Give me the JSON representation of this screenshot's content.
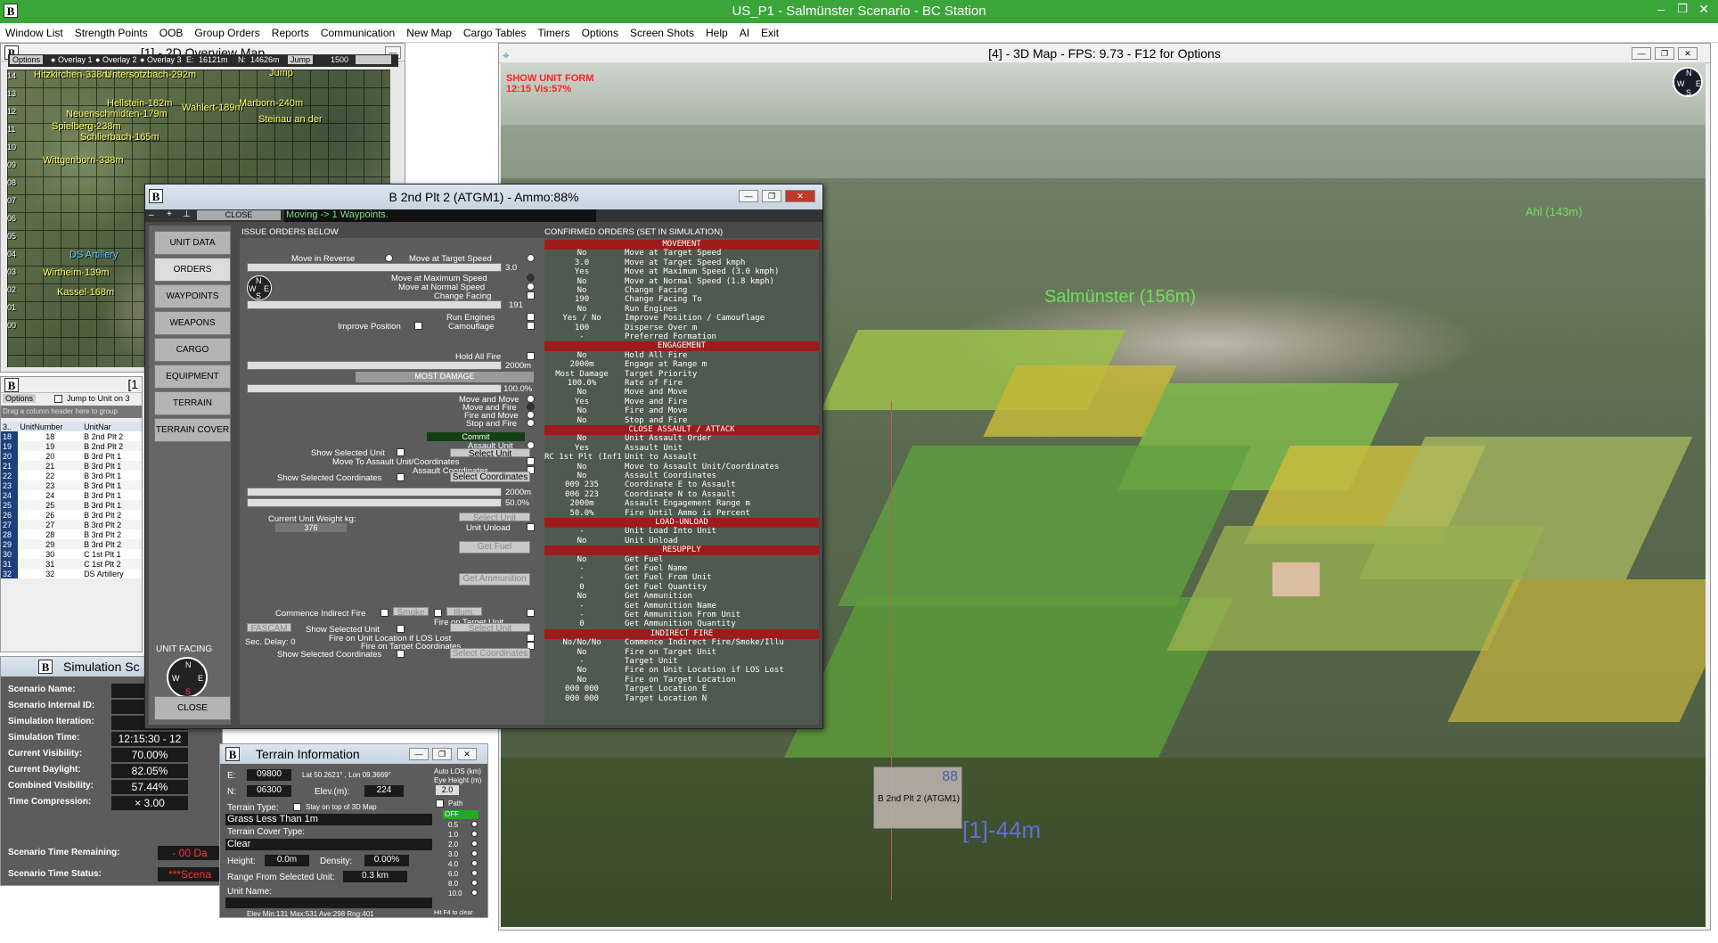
{
  "app": {
    "title": "US_P1 - Salmünster Scenario - BC Station"
  },
  "menu": [
    "Window List",
    "Strength Points",
    "OOB",
    "Group Orders",
    "Reports",
    "Communication",
    "New Map",
    "Cargo Tables",
    "Timers",
    "Options",
    "Screen Shots",
    "Help",
    "AI",
    "Exit"
  ],
  "overview": {
    "title": "[1] - 2D Overview Map",
    "options_label": "Options",
    "overlays": [
      "Overlay 1",
      "Overlay 2",
      "Overlay 3"
    ],
    "e_label": "E:",
    "e_val": "16121m",
    "n_label": "N:",
    "n_val": "14626m",
    "jump": "Jump",
    "zoom": "1500",
    "towns": [
      "Hitzkirchen-338m",
      "Untersotzbach-292m",
      "Jump",
      "Hellstein-182m",
      "Wahlert-189m",
      "Marborn-240m",
      "Neuenschmidten-179m",
      "Spielberg-238m",
      "Steinau an der",
      "Schlierbach-165m",
      "Wittgenborn-338m",
      "DS Artillery",
      "Wirtheim-139m",
      "Kassel-168m"
    ],
    "grid_rows": [
      "14",
      "13",
      "12",
      "11",
      "10",
      "09",
      "08",
      "07",
      "06",
      "05",
      "04",
      "03",
      "02",
      "01",
      "00"
    ]
  },
  "map3d": {
    "title": "[4] - 3D Map - FPS: 9.73 - F12 for Options",
    "show_unit_form": "SHOW UNIT FORM",
    "time_vis": "12:15 Vis:57%",
    "town": "Salmünster (156m)",
    "ahl": "Ahl (143m)",
    "unit_label": "B 2nd Plt 2 (ATGM1)",
    "unit_num": "88",
    "unit_range": "[1]-44m"
  },
  "unitlist": {
    "title": "[1",
    "options_label": "Options",
    "jump_label": "Jump to Unit on 3",
    "drag_hint": "Drag a column header here to group",
    "col1": "3..",
    "col2": "UnitNumber",
    "col3": "UnitNar",
    "rows": [
      [
        "18",
        "18",
        "B 2nd Plt 2"
      ],
      [
        "19",
        "19",
        "B 2nd Plt 2"
      ],
      [
        "20",
        "20",
        "B 3rd Plt 1"
      ],
      [
        "21",
        "21",
        "B 3rd Plt 1"
      ],
      [
        "22",
        "22",
        "B 3rd Plt 1"
      ],
      [
        "23",
        "23",
        "B 3rd Plt 1"
      ],
      [
        "24",
        "24",
        "B 3rd Plt 1"
      ],
      [
        "25",
        "25",
        "B 3rd Plt 1"
      ],
      [
        "26",
        "26",
        "B 3rd Plt 2"
      ],
      [
        "27",
        "27",
        "B 3rd Plt 2"
      ],
      [
        "28",
        "28",
        "B 3rd Plt 2"
      ],
      [
        "29",
        "29",
        "B 3rd Plt 2"
      ],
      [
        "30",
        "30",
        "C 1st Plt 1"
      ],
      [
        "31",
        "31",
        "C 1st Plt 2"
      ],
      [
        "32",
        "32",
        "DS Artillery"
      ]
    ]
  },
  "simulation": {
    "title": "Simulation Sc",
    "rows": [
      {
        "k": "Scenario Name:",
        "v": ""
      },
      {
        "k": "Scenario Internal ID:",
        "v": ""
      },
      {
        "k": "Simulation Iteration:",
        "v": ""
      },
      {
        "k": "Simulation Time:",
        "v": "12:15:30 - 12"
      },
      {
        "k": "Current Visibility:",
        "v": "70.00%"
      },
      {
        "k": "Current Daylight:",
        "v": "82.05%"
      },
      {
        "k": "Combined Visibility:",
        "v": "57.44%"
      },
      {
        "k": "Time Compression:",
        "v": "× 3.00"
      }
    ],
    "remaining_label": "Scenario Time Remaining:",
    "remaining_val": "- 00 Da",
    "status_label": "Scenario Time Status:",
    "status_val": "***Scena"
  },
  "terrain": {
    "title": "Terrain Information",
    "e_label": "E:",
    "e_val": "09800",
    "latlon": "Lat 50.2621° , Lon 09.3669°",
    "n_label": "N:",
    "n_val": "06300",
    "elev_label": "Elev.(m):",
    "elev_val": "224",
    "type_label": "Terrain Type:",
    "stay_label": "Stay on top of 3D Map",
    "type_val": "Grass Less Than 1m",
    "cover_label": "Terrain Cover Type:",
    "cover_val": "Clear",
    "height_label": "Height:",
    "height_val": "0.0m",
    "density_label": "Density:",
    "density_val": "0.00%",
    "range_label": "Range From Selected Unit:",
    "range_val": "0.3 km",
    "unitname_label": "Unit Name:",
    "footer": "Elev Min:131 Max:531 Ave:298 Rng:401",
    "autolos": "Auto LOS (km)",
    "eyeh": "Eye Height (m)",
    "eyeh_val": "2.0",
    "path": "Path",
    "off": "OFF",
    "los_vals": [
      "0.5",
      "1.0",
      "2.0",
      "3.0",
      "4.0",
      "6.0",
      "8.0",
      "10.0"
    ],
    "hit": "Hit F4 to clear"
  },
  "unitform": {
    "title": "B 2nd Plt 2 (ATGM1) - Ammo:88%",
    "close_small": "CLOSE",
    "status": "Moving -> 1 Waypoints.",
    "issue_header": "ISSUE ORDERS BELOW",
    "confirmed_header": "CONFIRMED ORDERS (SET IN SIMULATION)",
    "nav": [
      "UNIT DATA",
      "ORDERS",
      "WAYPOINTS",
      "WEAPONS",
      "CARGO",
      "EQUIPMENT",
      "TERRAIN",
      "TERRAIN COVER"
    ],
    "unit_facing": "UNIT FACING",
    "close": "CLOSE",
    "labels": {
      "reverse": "Move in Reverse",
      "target_speed": "Move at Target Speed",
      "speed_val": "3.0",
      "max_speed": "Move at Maximum Speed",
      "normal_speed": "Move at Normal Speed",
      "change_facing": "Change Facing",
      "facing_val": "191",
      "run_engines": "Run Engines",
      "improve": "Improve Position",
      "camouflage": "Camouflage",
      "hold_fire": "Hold All Fire",
      "range_val": "2000m",
      "most_damage": "MOST DAMAGE",
      "rate_val": "100.0%",
      "move_move": "Move and Move",
      "move_fire": "Move and Fire",
      "fire_move": "Fire and Move",
      "stop_fire": "Stop and Fire",
      "commit": "Commit",
      "assault": "Assault Unit",
      "show_sel": "Show Selected Unit",
      "select_unit": "Select Unit",
      "move_to_assault": "Move To Assault Unit/Coordinates",
      "assault_coords": "Assault Coordinates",
      "show_sel_coords": "Show Selected Coordinates",
      "select_coords": "Select Coordinates",
      "eng_range": "2000m",
      "fire_until": "50.0%",
      "weight": "Current Unit Weight kg:",
      "weight_val": "376",
      "select_unit2": "Select Unit",
      "unit_unload": "Unit Unload",
      "get_fuel": "Get Fuel",
      "get_ammo": "Get Ammunition",
      "indirect": "Commence Indirect Fire",
      "smoke": "Smoke",
      "illum": "Illum.",
      "fire_target": "Fire on Target Unit",
      "fascam": "FASCAM",
      "show_sel2": "Show Selected Unit",
      "select_unit3": "Select Unit",
      "fire_los": "Fire on Unit Location if LOS Lost",
      "fire_loc": "Fire on Target Coordinates",
      "sec_delay": "Sec. Delay: 0",
      "show_coords2": "Show Selected Coordinates",
      "select_coords2": "Select Coordinates"
    },
    "orders": [
      {
        "s": "MOVEMENT"
      },
      {
        "v": "No",
        "d": "Move at Target Speed"
      },
      {
        "v": "3.0",
        "d": "Move at Target Speed kmph"
      },
      {
        "v": "Yes",
        "d": "Move at Maximum Speed (3.0 kmph)"
      },
      {
        "v": "No",
        "d": "Move at Normal Speed (1.8 kmph)"
      },
      {
        "v": "No",
        "d": "Change Facing"
      },
      {
        "v": "190",
        "d": "Change Facing To"
      },
      {
        "v": "No",
        "d": "Run Engines"
      },
      {
        "v": "Yes / No",
        "d": "Improve Position / Camouflage"
      },
      {
        "v": "100",
        "d": "Disperse Over m"
      },
      {
        "v": "-",
        "d": "Preferred Formation"
      },
      {
        "s": "ENGAGEMENT"
      },
      {
        "v": "No",
        "d": "Hold All Fire"
      },
      {
        "v": "2000m",
        "d": "Engage at Range m"
      },
      {
        "v": "Most Damage",
        "d": "Target Priority"
      },
      {
        "v": "100.0%",
        "d": "Rate of Fire"
      },
      {
        "v": "No",
        "d": "Move and Move"
      },
      {
        "v": "Yes",
        "d": "Move and Fire"
      },
      {
        "v": "No",
        "d": "Fire and Move"
      },
      {
        "v": "No",
        "d": "Stop and Fire"
      },
      {
        "s": "CLOSE ASSAULT / ATTACK"
      },
      {
        "v": "No",
        "d": "Unit Assault Order"
      },
      {
        "v": "Yes",
        "d": "Assault Unit"
      },
      {
        "v": "RC 1st Plt (Inf1",
        "d": "Unit to Assault"
      },
      {
        "v": "No",
        "d": "Move to Assault Unit/Coordinates"
      },
      {
        "v": "No",
        "d": "Assault Coordinates"
      },
      {
        "v": "009 235",
        "d": "Coordinate E to Assault"
      },
      {
        "v": "006 223",
        "d": "Coordinate N to Assault"
      },
      {
        "v": "2000m",
        "d": "Assault Engagement Range m"
      },
      {
        "v": "50.0%",
        "d": "Fire Until Ammo is Percent"
      },
      {
        "s": "LOAD-UNLOAD"
      },
      {
        "v": "-",
        "d": "Unit Load Into Unit"
      },
      {
        "v": "No",
        "d": "Unit Unload"
      },
      {
        "s": "RESUPPLY"
      },
      {
        "v": "No",
        "d": "Get Fuel"
      },
      {
        "v": "-",
        "d": "Get Fuel Name"
      },
      {
        "v": "-",
        "d": "Get Fuel From Unit"
      },
      {
        "v": "0",
        "d": "Get Fuel Quantity"
      },
      {
        "v": "No",
        "d": "Get Ammunition"
      },
      {
        "v": "-",
        "d": "Get Ammunition Name"
      },
      {
        "v": "-",
        "d": "Get Ammunition From Unit"
      },
      {
        "v": "0",
        "d": "Get Ammunition Quantity"
      },
      {
        "s": "INDIRECT FIRE"
      },
      {
        "v": "No/No/No",
        "d": "Commence Indirect Fire/Smoke/Illu"
      },
      {
        "v": "No",
        "d": "Fire on Target Unit"
      },
      {
        "v": "-",
        "d": "Target Unit"
      },
      {
        "v": "No",
        "d": "Fire on Unit Location if LOS Lost"
      },
      {
        "v": "No",
        "d": "Fire on Target Location"
      },
      {
        "v": "000 000",
        "d": "Target Location E"
      },
      {
        "v": "000 000",
        "d": "Target Location N"
      }
    ]
  },
  "colors": {
    "titlebar": "#3aa63a",
    "section": "#9e1b1b",
    "panel": "#5c5c5c"
  }
}
